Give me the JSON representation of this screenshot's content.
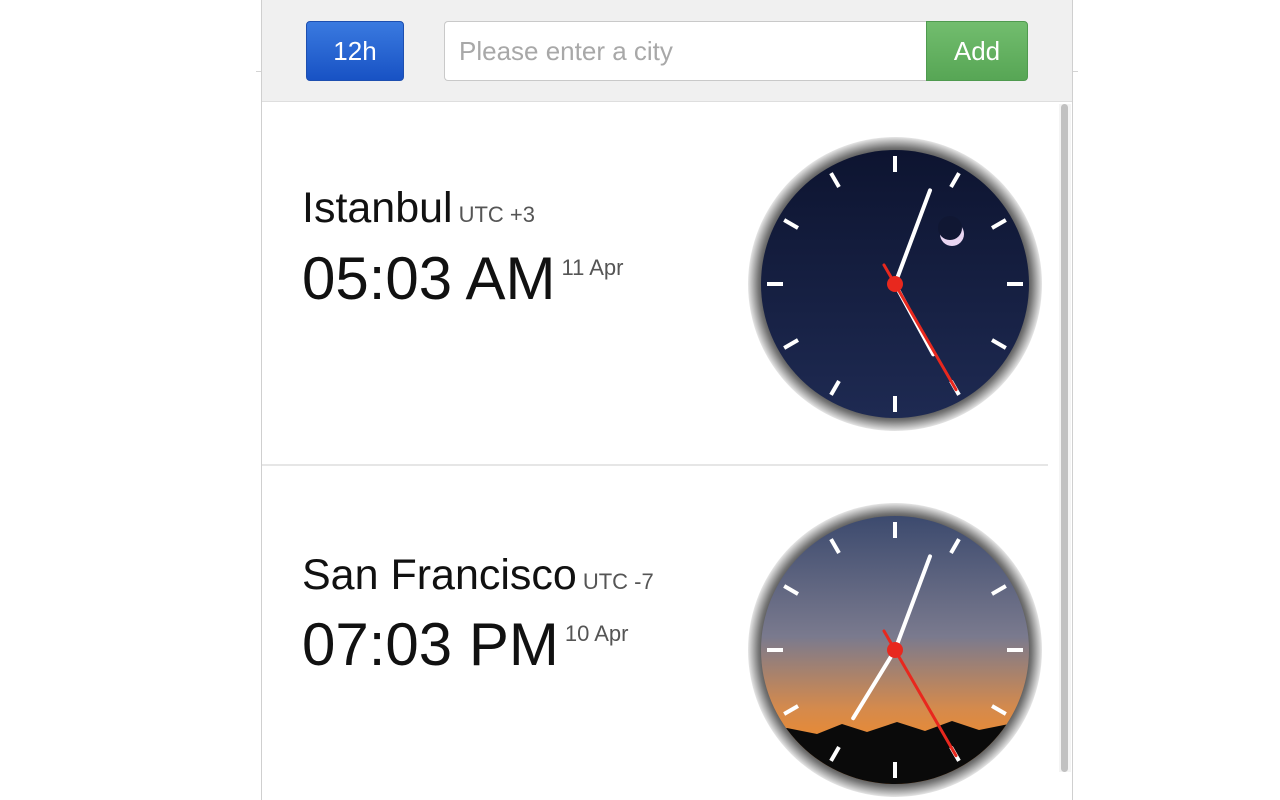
{
  "toolbar": {
    "format_label": "12h",
    "city_placeholder": "Please enter a city",
    "add_label": "Add"
  },
  "cities": [
    {
      "name": "Istanbul",
      "utc": "UTC +3",
      "time": "05:03 AM",
      "date": "11 Apr",
      "clock": {
        "hour": 5,
        "minute": 3,
        "second": 25,
        "theme": "night"
      }
    },
    {
      "name": "San Francisco",
      "utc": "UTC -7",
      "time": "07:03 PM",
      "date": "10 Apr",
      "clock": {
        "hour": 7,
        "minute": 3,
        "second": 25,
        "theme": "dusk"
      }
    }
  ],
  "colors": {
    "format_button": "#1852c4",
    "add_button": "#57a655",
    "second_hand": "#e8281e",
    "night_sky": "#101733",
    "dusk_top": "#3c4a6e",
    "dusk_bottom": "#f08a2a"
  }
}
